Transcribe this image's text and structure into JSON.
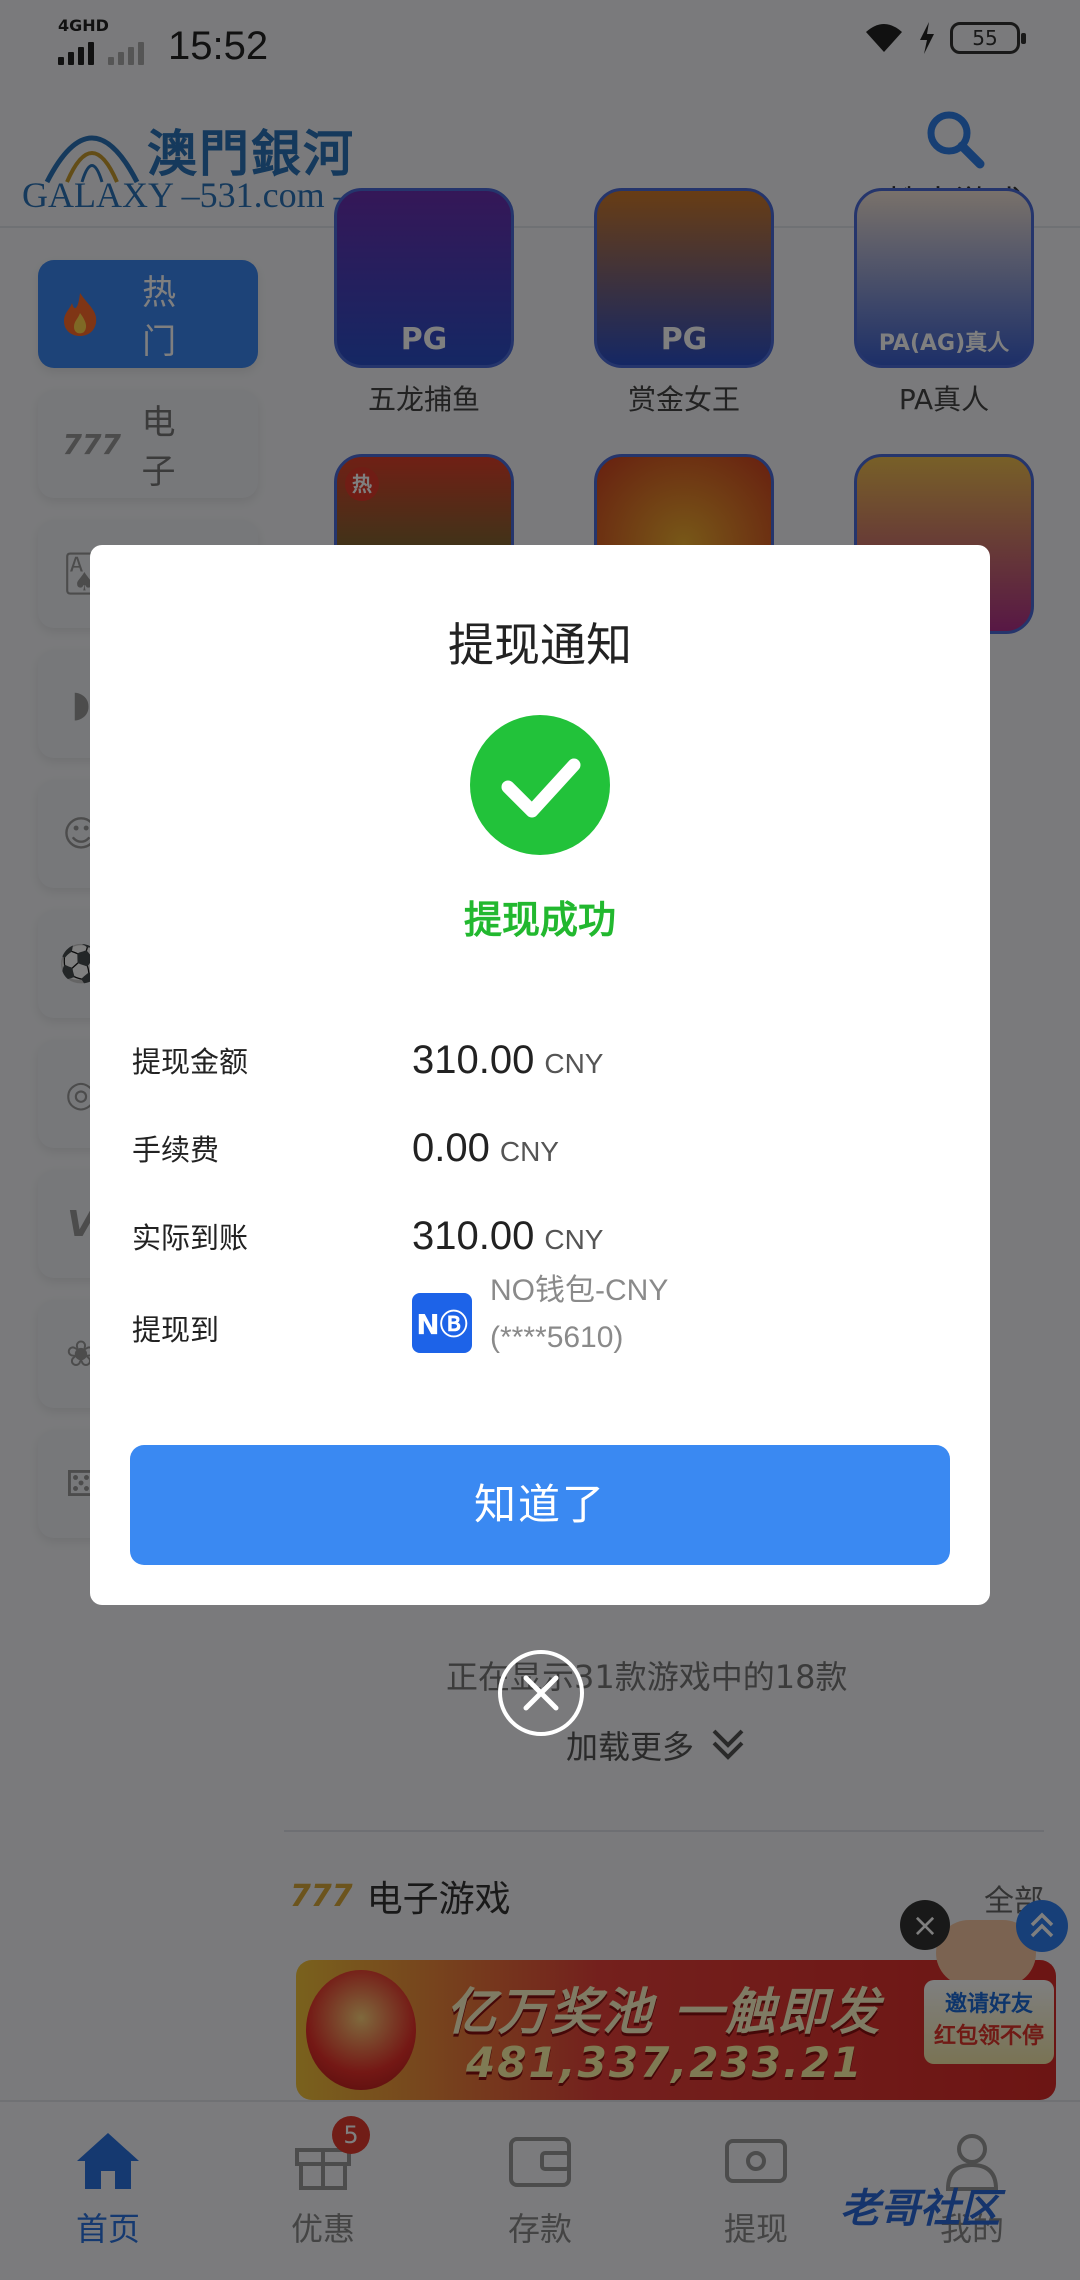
{
  "status_bar": {
    "network": "4GHD",
    "time": "15:52",
    "battery": "55"
  },
  "header": {
    "logo_cn": "澳門銀河",
    "logo_en": "GALAXY –531.com –",
    "search_label": "搜索游戏"
  },
  "sidebar": {
    "items": [
      {
        "label": "热 门",
        "icon": "flame-icon",
        "active": true
      },
      {
        "label": "电 子",
        "icon": "slots-777-icon",
        "active": false
      },
      {
        "label": "",
        "icon": "cards-icon",
        "active": false
      },
      {
        "label": "",
        "icon": "fish-icon",
        "active": false
      },
      {
        "label": "",
        "icon": "dealer-icon",
        "active": false
      },
      {
        "label": "",
        "icon": "soccer-icon",
        "active": false
      },
      {
        "label": "",
        "icon": "esports-icon",
        "active": false
      },
      {
        "label": "",
        "icon": "vs-icon",
        "active": false
      },
      {
        "label": "",
        "icon": "lottery-icon",
        "active": false
      },
      {
        "label": "",
        "icon": "dice-icon",
        "active": false
      }
    ]
  },
  "games": [
    {
      "name": "五龙捕鱼",
      "tag": "PG"
    },
    {
      "name": "赏金女王",
      "tag": "PG"
    },
    {
      "name": "PA真人",
      "tag": "PA(AG)真人"
    },
    {
      "name": "",
      "tag": "热"
    },
    {
      "name": "",
      "tag": ""
    },
    {
      "name": "",
      "tag": ""
    }
  ],
  "list_footer": {
    "count_text": "正在显示31款游戏中的18款",
    "load_more": "加载更多"
  },
  "section": {
    "icon_text": "777",
    "title": "电子游戏",
    "all": "全部"
  },
  "banner": {
    "title": "亿万奖池 一触即发",
    "number": "481,337,233.21"
  },
  "invite": {
    "line1": "邀请好友",
    "line2": "红包领不停"
  },
  "bottom_nav": [
    {
      "label": "首页",
      "icon": "home-icon",
      "active": true
    },
    {
      "label": "优惠",
      "icon": "gift-icon",
      "active": false,
      "badge": "5"
    },
    {
      "label": "存款",
      "icon": "wallet-icon",
      "active": false
    },
    {
      "label": "提现",
      "icon": "withdraw-icon",
      "active": false
    },
    {
      "label": "我的",
      "icon": "user-icon",
      "active": false
    }
  ],
  "watermark": "老哥社区",
  "modal": {
    "title": "提现通知",
    "status": "提现成功",
    "rows": [
      {
        "label": "提现金额",
        "value": "310.00",
        "unit": "CNY"
      },
      {
        "label": "手续费",
        "value": "0.00",
        "unit": "CNY"
      },
      {
        "label": "实际到账",
        "value": "310.00",
        "unit": "CNY"
      }
    ],
    "wallet_label": "提现到",
    "wallet_logo": "NⒷ",
    "wallet_name": "NO钱包-CNY",
    "wallet_account": "(****5610)",
    "confirm": "知道了"
  },
  "colors": {
    "accent": "#3a89f2",
    "success": "#22c23a",
    "badge": "#e33a2e"
  }
}
